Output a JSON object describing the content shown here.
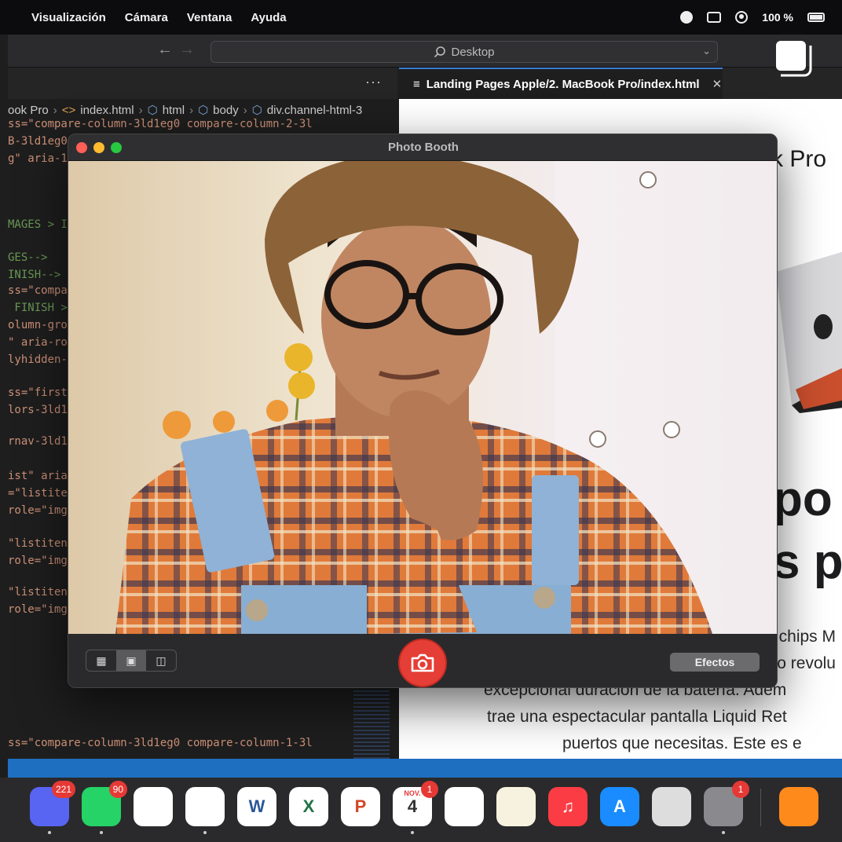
{
  "menubar": {
    "items": [
      "Visualización",
      "Cámara",
      "Ventana",
      "Ayuda"
    ],
    "battery": "100 %"
  },
  "toolbar": {
    "search_text": "Desktop"
  },
  "editor": {
    "more": "···",
    "breadcrumb": [
      "ook Pro",
      "index.html",
      "html",
      "body",
      "div.channel-html-3"
    ],
    "lines": [
      {
        "text": "ss=\"compare-column-3ld1eg0 compare-column-2-3l",
        "cls": ""
      },
      {
        "text": "B-3ld1eg0",
        "cls": ""
      },
      {
        "text": "g\" aria-1",
        "cls": ""
      },
      {
        "text": "MAGES > I",
        "cls": "green"
      },
      {
        "text": "GES-->",
        "cls": "green"
      },
      {
        "text": "INISH-->",
        "cls": "green"
      },
      {
        "text": "ss=\"compa",
        "cls": ""
      },
      {
        "text": " FINISH >",
        "cls": "green"
      },
      {
        "text": "olumn-gro",
        "cls": ""
      },
      {
        "text": "\" aria-ro",
        "cls": ""
      },
      {
        "text": "lyhidden-",
        "cls": ""
      },
      {
        "text": "ss=\"first",
        "cls": ""
      },
      {
        "text": "lors-3ld1",
        "cls": ""
      },
      {
        "text": "rnav-3ld1",
        "cls": ""
      },
      {
        "text": "ist\" aria",
        "cls": ""
      },
      {
        "text": "=\"listiten",
        "cls": ""
      },
      {
        "text": "role=\"img",
        "cls": ""
      },
      {
        "text": "\"listiten",
        "cls": ""
      },
      {
        "text": "role=\"img",
        "cls": ""
      },
      {
        "text": "\"listiten",
        "cls": ""
      },
      {
        "text": "role=\"img",
        "cls": ""
      },
      {
        "text": "ss=\"compare-column-3ld1eg0 compare-column-1-3l",
        "cls": ""
      }
    ]
  },
  "browser": {
    "tab_title": "Landing Pages Apple/2. MacBook Pro/index.html",
    "page_title_fragment": "k Pro",
    "big_line_1": "po",
    "big_line_2": "s p",
    "para": [
      "chips M",
      "o revolu",
      "excepcional duración de la batería. Adem",
      "trae una espectacular pantalla Liquid Ret",
      "puertos que necesitas. Este es e"
    ]
  },
  "photobooth": {
    "title": "Photo Booth",
    "effects_label": "Efectos"
  },
  "dock": {
    "apps": [
      {
        "name": "discord",
        "label": "",
        "badge": "221",
        "color": "#5865F2"
      },
      {
        "name": "whatsapp",
        "label": "",
        "badge": "90",
        "color": "#25D366"
      },
      {
        "name": "clickup",
        "label": "",
        "badge": "",
        "color": "#ffffff"
      },
      {
        "name": "vscode",
        "label": "",
        "badge": "",
        "color": "#ffffff"
      },
      {
        "name": "word",
        "label": "W",
        "badge": "",
        "color": "#ffffff"
      },
      {
        "name": "excel",
        "label": "X",
        "badge": "",
        "color": "#ffffff"
      },
      {
        "name": "powerpoint",
        "label": "P",
        "badge": "",
        "color": "#ffffff"
      },
      {
        "name": "calendar",
        "label": "4",
        "badge": "1",
        "color": "#ffffff",
        "month": "NOV."
      },
      {
        "name": "reminders",
        "label": "",
        "badge": "",
        "color": "#ffffff"
      },
      {
        "name": "notes",
        "label": "",
        "badge": "",
        "color": "#f7f2df"
      },
      {
        "name": "music",
        "label": "♫",
        "badge": "",
        "color": "#fc3c44"
      },
      {
        "name": "app-store",
        "label": "A",
        "badge": "",
        "color": "#1a8cff"
      },
      {
        "name": "preview",
        "label": "",
        "badge": "",
        "color": "#dddddd"
      },
      {
        "name": "system-settings",
        "label": "",
        "badge": "1",
        "color": "#8a8a8e"
      },
      {
        "name": "books",
        "label": "",
        "badge": "",
        "color": "#ff8a1c"
      }
    ]
  }
}
